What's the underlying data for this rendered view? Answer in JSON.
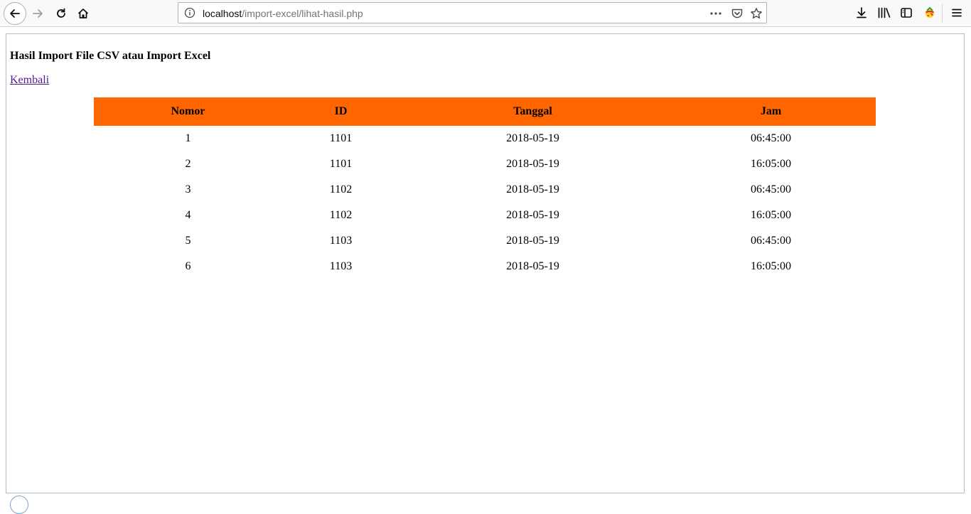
{
  "browser": {
    "url_host": "localhost",
    "url_path": "/import-excel/lihat-hasil.php"
  },
  "icons": {
    "back": "back-arrow-icon",
    "forward": "forward-arrow-icon",
    "reload": "reload-icon",
    "home": "home-icon",
    "info": "info-icon",
    "page_actions": "more-horizontal-icon",
    "pocket": "pocket-icon",
    "bookmark": "star-icon",
    "downloads": "download-icon",
    "library": "library-icon",
    "sidebar": "sidebar-icon",
    "extension": "extension-icon",
    "menu": "hamburger-menu-icon"
  },
  "page": {
    "title": "Hasil Import File CSV atau Import Excel",
    "back_link": "Kembali"
  },
  "table": {
    "header_color": "#ff6600",
    "columns": [
      "Nomor",
      "ID",
      "Tanggal",
      "Jam"
    ],
    "rows": [
      [
        "1",
        "1101",
        "2018-05-19",
        "06:45:00"
      ],
      [
        "2",
        "1101",
        "2018-05-19",
        "16:05:00"
      ],
      [
        "3",
        "1102",
        "2018-05-19",
        "06:45:00"
      ],
      [
        "4",
        "1102",
        "2018-05-19",
        "16:05:00"
      ],
      [
        "5",
        "1103",
        "2018-05-19",
        "06:45:00"
      ],
      [
        "6",
        "1103",
        "2018-05-19",
        "16:05:00"
      ]
    ]
  }
}
